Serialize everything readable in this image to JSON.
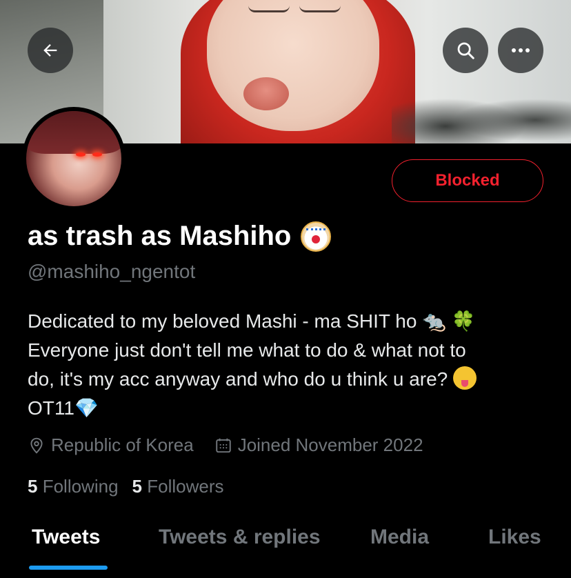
{
  "profile": {
    "display_name": "as trash as Mashiho",
    "display_name_emoji": "clown-face",
    "handle": "@mashiho_ngentot",
    "bio_line1_text": "Dedicated to my beloved Mashi - ma SHIT ho ",
    "bio_line2": "Everyone just don't tell me what to do & what not to",
    "bio_line3_text": "do, it's my acc anyway and who do u think u are? ",
    "bio_line4_text": "OT11",
    "bio_emoji_rat": "🐀",
    "bio_emoji_clover": "🍀",
    "bio_emoji_gem": "💎",
    "location": "Republic of Korea",
    "joined": "Joined November 2022",
    "following_count": "5",
    "following_label": "Following",
    "followers_count": "5",
    "followers_label": "Followers"
  },
  "actions": {
    "blocked_label": "Blocked",
    "back_icon": "arrow-left-icon",
    "search_icon": "search-icon",
    "more_icon": "more-horizontal-icon"
  },
  "tabs": [
    {
      "label": "Tweets",
      "active": true
    },
    {
      "label": "Tweets & replies",
      "active": false
    },
    {
      "label": "Media",
      "active": false
    },
    {
      "label": "Likes",
      "active": false
    }
  ],
  "colors": {
    "accent_blue": "#1d9bf0",
    "blocked_red": "#f4212e",
    "secondary_text": "#71767b",
    "background": "#000000"
  }
}
